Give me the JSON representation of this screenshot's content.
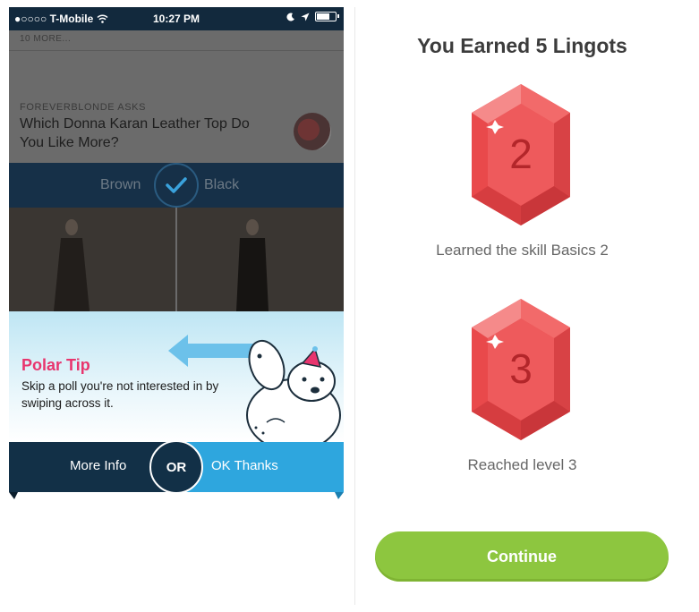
{
  "left_screen": {
    "status_bar": {
      "carrier": "●○○○○ T-Mobile",
      "time": "10:27 PM"
    },
    "feed": {
      "more_line": "10 MORE...",
      "asker_label": "FOREVERBLONDE ASKS",
      "question": "Which Donna Karan Leather Top Do You Like More?",
      "option_left": "Brown",
      "option_right": "Black"
    },
    "tip": {
      "title": "Polar Tip",
      "text": "Skip a poll you're not interested in by swiping across it."
    },
    "actions": {
      "more_info": "More Info",
      "or": "OR",
      "ok_thanks": "OK Thanks"
    },
    "colors": {
      "navy": "#123047",
      "blue": "#2ea6de",
      "pink": "#e8356e"
    }
  },
  "right_screen": {
    "title": "You Earned 5 Lingots",
    "rewards": [
      {
        "number": "2",
        "caption": "Learned the skill Basics 2"
      },
      {
        "number": "3",
        "caption": "Reached level 3"
      }
    ],
    "continue_label": "Continue",
    "colors": {
      "gem_red": "#e9494b",
      "continue_green": "#8dc63f"
    }
  }
}
